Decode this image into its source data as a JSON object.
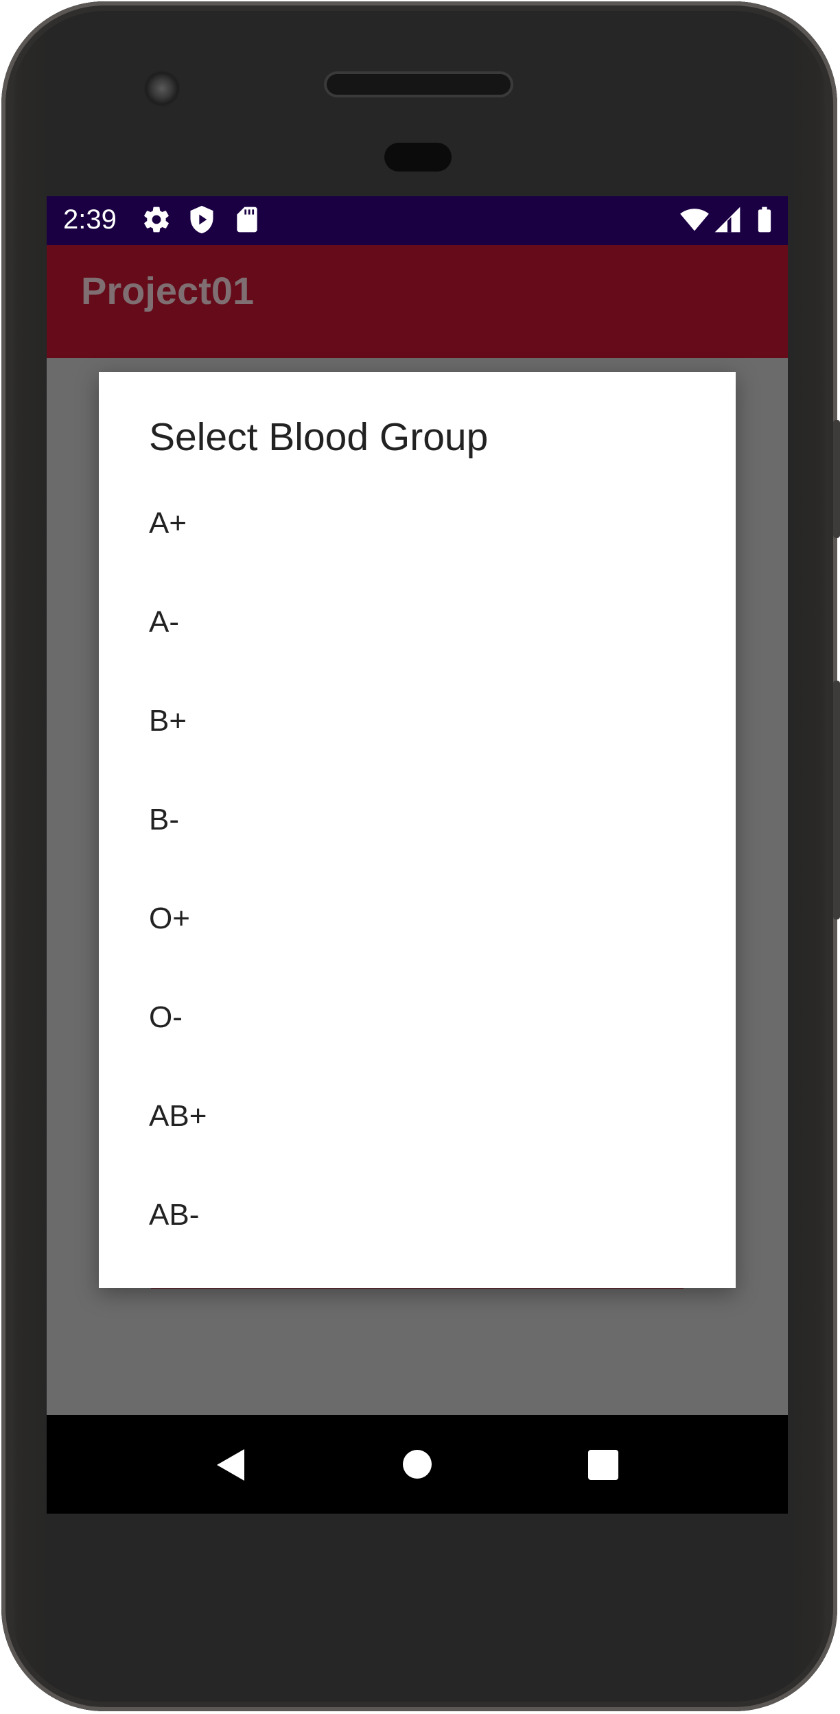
{
  "status_bar": {
    "time": "2:39",
    "left_icons": [
      "gear-icon",
      "shield-play-icon",
      "sd-card-icon"
    ],
    "right_icons": [
      "wifi-icon",
      "cell-signal-icon",
      "battery-icon"
    ]
  },
  "app_bar": {
    "title": "Project01"
  },
  "dialog": {
    "title": "Select Blood Group",
    "options": [
      "A+",
      "A-",
      "B+",
      "B-",
      "O+",
      "O-",
      "AB+",
      "AB-"
    ]
  },
  "nav_bar": {
    "icons": [
      "back-icon",
      "home-icon",
      "recents-icon"
    ]
  },
  "colors": {
    "status_bar": "#1a0043",
    "app_bar": "#650b1a",
    "scrim": "#6b6b6b",
    "dialog_bg": "#ffffff"
  }
}
